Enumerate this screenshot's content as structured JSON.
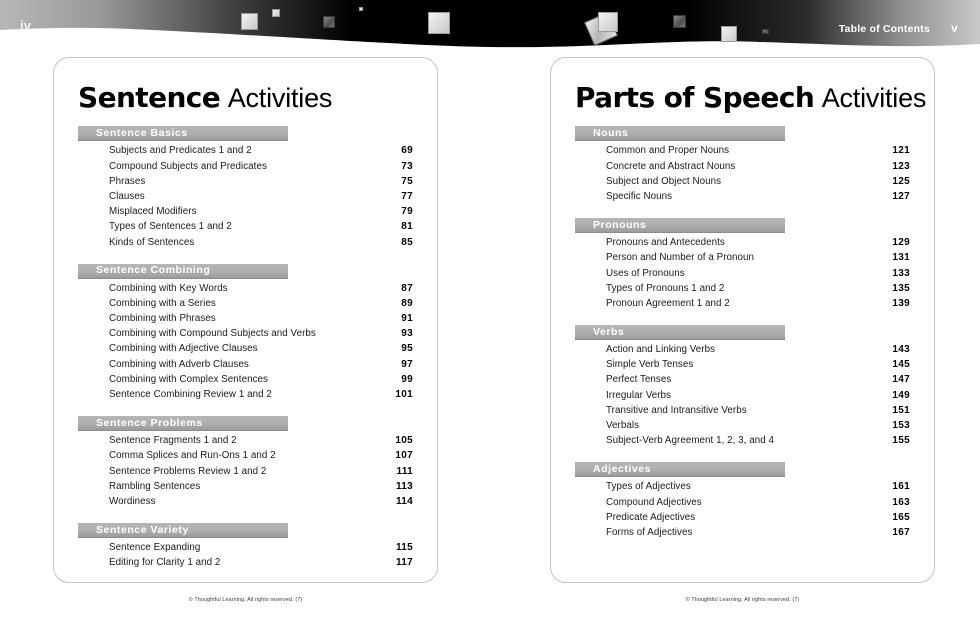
{
  "header": {
    "folio_left": "iv",
    "toc_label": "Table of Contents",
    "folio_right": "v",
    "banner_color_dark": "#000000",
    "banner_color_light": "#b0b0b0",
    "decorations": [
      {
        "name": "deco-square-1",
        "style": "light"
      },
      {
        "name": "deco-square-2",
        "style": "light"
      },
      {
        "name": "deco-square-3",
        "style": "dark"
      },
      {
        "name": "deco-square-4",
        "style": "light"
      },
      {
        "name": "deco-square-5",
        "style": "light"
      },
      {
        "name": "deco-square-tilted",
        "style": "tilt"
      },
      {
        "name": "deco-square-6",
        "style": "dark"
      },
      {
        "name": "deco-square-7",
        "style": "light"
      },
      {
        "name": "deco-square-8",
        "style": "dark"
      }
    ]
  },
  "pages": [
    {
      "title_strong": "Sentence",
      "title_light": "Activities",
      "footer": "© Thoughtful Learning.  All rights reserved.  (7)",
      "sections": [
        {
          "label": "Sentence Basics",
          "entries": [
            {
              "title": "Subjects and Predicates 1 and 2",
              "page": "69"
            },
            {
              "title": "Compound Subjects and Predicates",
              "page": "73"
            },
            {
              "title": "Phrases",
              "page": "75"
            },
            {
              "title": "Clauses",
              "page": "77"
            },
            {
              "title": "Misplaced Modifiers",
              "page": "79"
            },
            {
              "title": "Types of Sentences 1 and 2",
              "page": "81"
            },
            {
              "title": "Kinds of Sentences",
              "page": "85"
            }
          ]
        },
        {
          "label": "Sentence Combining",
          "entries": [
            {
              "title": "Combining with Key Words",
              "page": "87"
            },
            {
              "title": "Combining with a Series",
              "page": "89"
            },
            {
              "title": "Combining with Phrases",
              "page": "91"
            },
            {
              "title": "Combining with Compound Subjects and Verbs",
              "page": "93"
            },
            {
              "title": "Combining with Adjective Clauses",
              "page": "95"
            },
            {
              "title": "Combining with Adverb Clauses",
              "page": "97"
            },
            {
              "title": "Combining with Complex Sentences",
              "page": "99"
            },
            {
              "title": "Sentence Combining Review 1 and 2",
              "page": "101"
            }
          ]
        },
        {
          "label": "Sentence Problems",
          "entries": [
            {
              "title": "Sentence Fragments 1 and 2",
              "page": "105"
            },
            {
              "title": "Comma Splices and Run-Ons 1 and 2",
              "page": "107"
            },
            {
              "title": "Sentence Problems Review 1 and 2",
              "page": "111"
            },
            {
              "title": "Rambling Sentences",
              "page": "113"
            },
            {
              "title": "Wordiness",
              "page": "114"
            }
          ]
        },
        {
          "label": "Sentence Variety",
          "entries": [
            {
              "title": "Sentence Expanding",
              "page": "115"
            },
            {
              "title": "Editing for Clarity 1 and 2",
              "page": "117"
            }
          ]
        }
      ]
    },
    {
      "title_strong": "Parts of Speech",
      "title_light": "Activities",
      "footer": "© Thoughtful Learning.  All rights reserved.  (7)",
      "sections": [
        {
          "label": "Nouns",
          "entries": [
            {
              "title": "Common and Proper Nouns",
              "page": "121"
            },
            {
              "title": "Concrete and Abstract Nouns",
              "page": "123"
            },
            {
              "title": "Subject and Object Nouns",
              "page": "125"
            },
            {
              "title": "Specific Nouns",
              "page": "127"
            }
          ]
        },
        {
          "label": "Pronouns",
          "entries": [
            {
              "title": "Pronouns and Antecedents",
              "page": "129"
            },
            {
              "title": "Person and Number of a Pronoun",
              "page": "131"
            },
            {
              "title": "Uses of Pronouns",
              "page": "133"
            },
            {
              "title": "Types of Pronouns 1 and 2",
              "page": "135"
            },
            {
              "title": "Pronoun Agreement 1 and 2",
              "page": "139"
            }
          ]
        },
        {
          "label": "Verbs",
          "entries": [
            {
              "title": "Action and Linking Verbs",
              "page": "143"
            },
            {
              "title": "Simple Verb Tenses",
              "page": "145"
            },
            {
              "title": "Perfect Tenses",
              "page": "147"
            },
            {
              "title": "Irregular Verbs",
              "page": "149"
            },
            {
              "title": "Transitive and Intransitive Verbs",
              "page": "151"
            },
            {
              "title": "Verbals",
              "page": "153"
            },
            {
              "title": "Subject-Verb Agreement 1, 2, 3, and 4",
              "page": "155"
            }
          ]
        },
        {
          "label": "Adjectives",
          "entries": [
            {
              "title": "Types of Adjectives",
              "page": "161"
            },
            {
              "title": "Compound Adjectives",
              "page": "163"
            },
            {
              "title": "Predicate Adjectives",
              "page": "165"
            },
            {
              "title": "Forms of Adjectives",
              "page": "167"
            }
          ]
        }
      ]
    }
  ]
}
